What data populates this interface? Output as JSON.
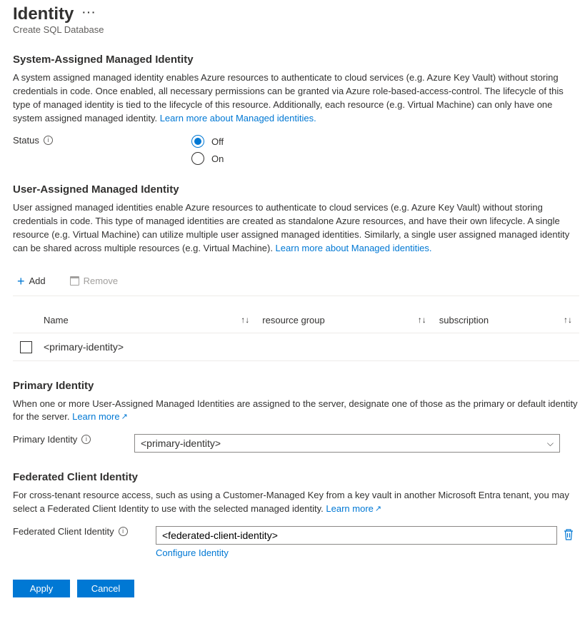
{
  "header": {
    "title": "Identity",
    "subtitle": "Create SQL Database"
  },
  "system_assigned": {
    "heading": "System-Assigned Managed Identity",
    "desc": "A system assigned managed identity enables Azure resources to authenticate to cloud services (e.g. Azure Key Vault) without storing credentials in code. Once enabled, all necessary permissions can be granted via Azure role-based-access-control. The lifecycle of this type of managed identity is tied to the lifecycle of this resource. Additionally, each resource (e.g. Virtual Machine) can only have one system assigned managed identity. ",
    "learn_more": "Learn more about Managed identities.",
    "status_label": "Status",
    "options": {
      "off": "Off",
      "on": "On"
    },
    "selected": "off"
  },
  "user_assigned": {
    "heading": "User-Assigned Managed Identity",
    "desc": "User assigned managed identities enable Azure resources to authenticate to cloud services (e.g. Azure Key Vault) without storing credentials in code. This type of managed identities are created as standalone Azure resources, and have their own lifecycle. A single resource (e.g. Virtual Machine) can utilize multiple user assigned managed identities. Similarly, a single user assigned managed identity can be shared across multiple resources (e.g. Virtual Machine). ",
    "learn_more": "Learn more about Managed identities.",
    "toolbar": {
      "add": "Add",
      "remove": "Remove"
    },
    "columns": {
      "name": "Name",
      "resource_group": "resource group",
      "subscription": "subscription"
    },
    "rows": [
      {
        "name": "<primary-identity>"
      }
    ]
  },
  "primary_identity": {
    "heading": "Primary Identity",
    "desc": "When one or more User-Assigned Managed Identities are assigned to the server, designate one of those as the primary or default identity for the server. ",
    "learn_more": "Learn more",
    "label": "Primary Identity",
    "value": "<primary-identity>"
  },
  "federated": {
    "heading": "Federated Client Identity",
    "desc": "For cross-tenant resource access, such as using a Customer-Managed Key from a key vault in another Microsoft Entra tenant, you may select a Federated Client Identity to use with the selected managed identity. ",
    "learn_more": "Learn more",
    "label": "Federated Client Identity",
    "value": "<federated-client-identity>",
    "configure": "Configure Identity"
  },
  "buttons": {
    "apply": "Apply",
    "cancel": "Cancel"
  }
}
